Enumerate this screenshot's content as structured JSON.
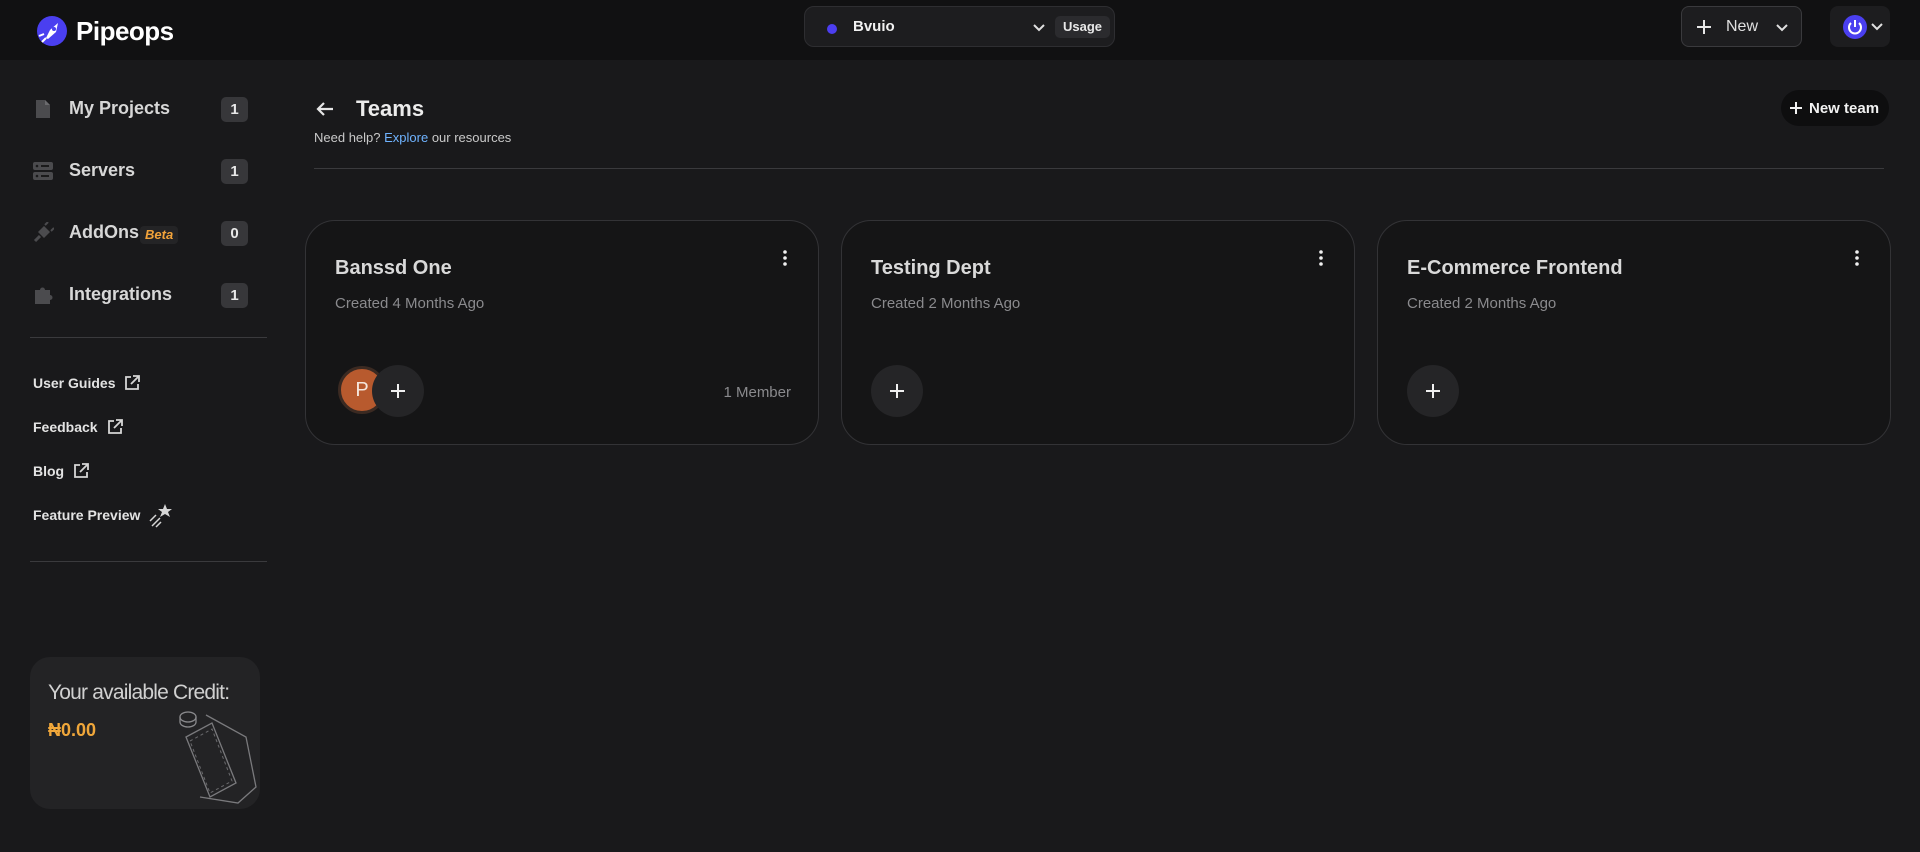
{
  "brand": {
    "name": "Pipeops"
  },
  "project_switcher": {
    "name": "Bvuio",
    "usage_label": "Usage",
    "dot_color": "#4c3ef0"
  },
  "header_actions": {
    "new_label": "New"
  },
  "sidebar": {
    "nav": [
      {
        "label": "My Projects",
        "count": "1",
        "icon": "file-icon"
      },
      {
        "label": "Servers",
        "count": "1",
        "icon": "server-icon"
      },
      {
        "label": "AddOns",
        "badge": "Beta",
        "count": "0",
        "icon": "plug-icon"
      },
      {
        "label": "Integrations",
        "count": "1",
        "icon": "puzzle-icon"
      }
    ],
    "links": [
      {
        "label": "User Guides",
        "icon": "external-link-icon"
      },
      {
        "label": "Feedback",
        "icon": "external-link-icon"
      },
      {
        "label": "Blog",
        "icon": "external-link-icon"
      },
      {
        "label": "Feature Preview",
        "icon": "sparkle-star-icon"
      }
    ],
    "credit": {
      "title": "Your available Credit:",
      "amount": "₦0.00",
      "accent_color": "#f0a73a"
    }
  },
  "page": {
    "title": "Teams",
    "help_prefix": "Need help?",
    "help_link": "Explore",
    "help_suffix": "our resources",
    "new_team_label": "New team"
  },
  "teams": [
    {
      "name": "Banssd One",
      "created": "Created 4 Months Ago",
      "member_initial": "P",
      "member_count": "1 Member"
    },
    {
      "name": "Testing Dept",
      "created": "Created 2 Months Ago"
    },
    {
      "name": "E-Commerce Frontend",
      "created": "Created 2 Months Ago"
    }
  ]
}
